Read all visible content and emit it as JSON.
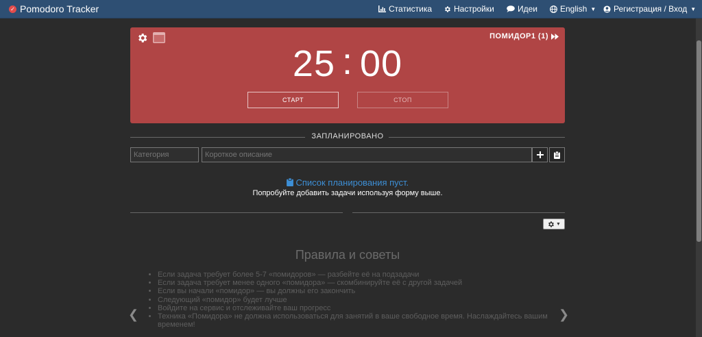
{
  "app": {
    "title": "Pomodoro Tracker"
  },
  "nav": {
    "stats": "Статистика",
    "settings": "Настройки",
    "ideas": "Идеи",
    "language": "English",
    "account": "Регистрация / Вход"
  },
  "timer": {
    "pomodoro_label": "ПОМИДОР1 (1)",
    "minutes": "25",
    "separator": ":",
    "seconds": "00",
    "start": "СТАРТ",
    "stop": "СТОП",
    "bg_color": "#b04545"
  },
  "planned": {
    "title": "ЗАПЛАНИРОВАНО",
    "category_placeholder": "Категория",
    "description_placeholder": "Короткое описание",
    "empty_title": "Список планирования пуст.",
    "empty_subtitle": "Попробуйте добавить задачи используя форму выше."
  },
  "tips": {
    "title": "Правила и советы",
    "items": [
      "Если задача требует более 5-7 «помидоров» — разбейте её на подзадачи",
      "Если задача требует менее одного «помидора» — скомбинируйте её с другой задачей",
      "Если вы начали «помидор» — вы должны его закончить",
      "Следующий «помидор» будет лучше",
      "Войдите на сервис и отслеживайте ваш прогресс",
      "Техника «Помидора» не должна использоваться для занятий в ваше свободное время. Наслаждайтесь вашим временем!"
    ]
  },
  "icons": {
    "brand": "check-circle-icon",
    "stats": "bar-chart-icon",
    "settings": "gear-icon",
    "ideas": "chat-bubble-icon",
    "language": "globe-icon",
    "account": "user-circle-icon"
  }
}
